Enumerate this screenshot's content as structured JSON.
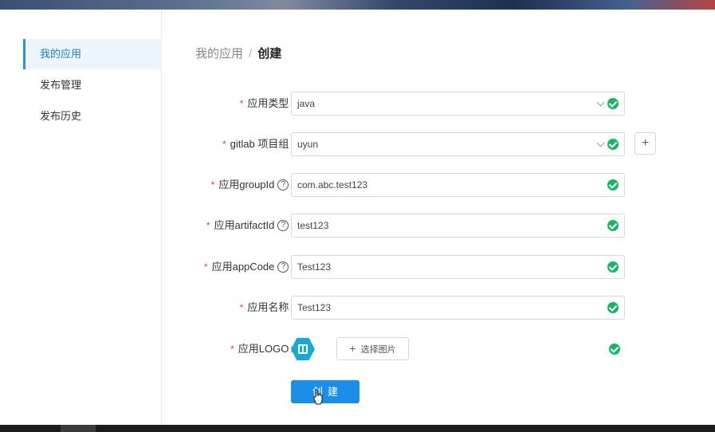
{
  "sidebar": {
    "items": [
      {
        "label": "我的应用",
        "active": true
      },
      {
        "label": "发布管理",
        "active": false
      },
      {
        "label": "发布历史",
        "active": false
      }
    ]
  },
  "breadcrumb": {
    "parent": "我的应用",
    "separator": "/",
    "current": "创建"
  },
  "form": {
    "required_mark": "*",
    "fields": {
      "app_type": {
        "label": "应用类型",
        "value": "java"
      },
      "gitlab_group": {
        "label": "gitlab 项目组",
        "value": "uyun"
      },
      "group_id": {
        "label": "应用groupId",
        "value": "com.abc.test123"
      },
      "artifact_id": {
        "label": "应用artifactId",
        "value": "test123"
      },
      "app_code": {
        "label": "应用appCode",
        "value": "Test123"
      },
      "app_name": {
        "label": "应用名称",
        "value": "Test123"
      },
      "logo": {
        "label": "应用LOGO",
        "choose_label": "选择图片"
      }
    },
    "colon": ":",
    "help_glyph": "?",
    "add_glyph": "+",
    "submit_label": "创建"
  },
  "colors": {
    "primary": "#1b8ee8",
    "success": "#18b566",
    "required": "#e0453a",
    "logo": "#19a9cf"
  }
}
